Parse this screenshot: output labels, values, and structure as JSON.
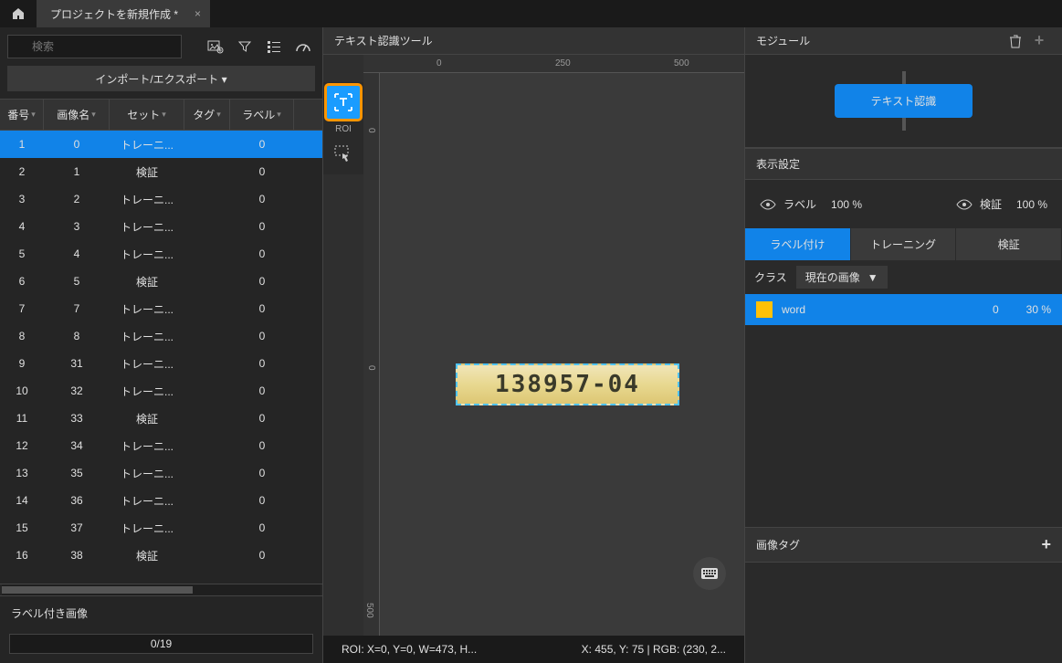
{
  "titlebar": {
    "tab_title": "プロジェクトを新規作成 *"
  },
  "left": {
    "search_placeholder": "検索",
    "import_export": "インポート/エクスポート ▾",
    "columns": {
      "num": "番号",
      "imgname": "画像名",
      "set": "セット",
      "tag": "タグ",
      "label": "ラベル"
    },
    "rows": [
      {
        "num": "1",
        "imgname": "0",
        "set": "トレーニ...",
        "tag": "",
        "label": "0"
      },
      {
        "num": "2",
        "imgname": "1",
        "set": "検証",
        "tag": "",
        "label": "0"
      },
      {
        "num": "3",
        "imgname": "2",
        "set": "トレーニ...",
        "tag": "",
        "label": "0"
      },
      {
        "num": "4",
        "imgname": "3",
        "set": "トレーニ...",
        "tag": "",
        "label": "0"
      },
      {
        "num": "5",
        "imgname": "4",
        "set": "トレーニ...",
        "tag": "",
        "label": "0"
      },
      {
        "num": "6",
        "imgname": "5",
        "set": "検証",
        "tag": "",
        "label": "0"
      },
      {
        "num": "7",
        "imgname": "7",
        "set": "トレーニ...",
        "tag": "",
        "label": "0"
      },
      {
        "num": "8",
        "imgname": "8",
        "set": "トレーニ...",
        "tag": "",
        "label": "0"
      },
      {
        "num": "9",
        "imgname": "31",
        "set": "トレーニ...",
        "tag": "",
        "label": "0"
      },
      {
        "num": "10",
        "imgname": "32",
        "set": "トレーニ...",
        "tag": "",
        "label": "0"
      },
      {
        "num": "11",
        "imgname": "33",
        "set": "検証",
        "tag": "",
        "label": "0"
      },
      {
        "num": "12",
        "imgname": "34",
        "set": "トレーニ...",
        "tag": "",
        "label": "0"
      },
      {
        "num": "13",
        "imgname": "35",
        "set": "トレーニ...",
        "tag": "",
        "label": "0"
      },
      {
        "num": "14",
        "imgname": "36",
        "set": "トレーニ...",
        "tag": "",
        "label": "0"
      },
      {
        "num": "15",
        "imgname": "37",
        "set": "トレーニ...",
        "tag": "",
        "label": "0"
      },
      {
        "num": "16",
        "imgname": "38",
        "set": "検証",
        "tag": "",
        "label": "0"
      }
    ],
    "labeled_heading": "ラベル付き画像",
    "progress": "0/19"
  },
  "center": {
    "title": "テキスト認識ツール",
    "roi_label": "ROI",
    "image_text": "138957-04",
    "ruler_h": {
      "t0": "0",
      "t250": "250",
      "t500": "500"
    },
    "ruler_v": {
      "t0": "0",
      "t500": "500"
    },
    "status_left": "ROI: X=0, Y=0, W=473, H...",
    "status_right": "X: 455, Y: 75 | RGB: (230, 2..."
  },
  "right": {
    "module_title": "モジュール",
    "module_btn": "テキスト認識",
    "display_title": "表示設定",
    "label_eye": "ラベル",
    "label_pct": "100 %",
    "verify_eye": "検証",
    "verify_pct": "100 %",
    "tabs": {
      "labeling": "ラベル付け",
      "training": "トレーニング",
      "verify": "検証"
    },
    "class_label": "クラス",
    "class_select": "現在の画像",
    "class_name": "word",
    "class_count": "0",
    "class_pct": "30 %",
    "imgtag_title": "画像タグ"
  }
}
